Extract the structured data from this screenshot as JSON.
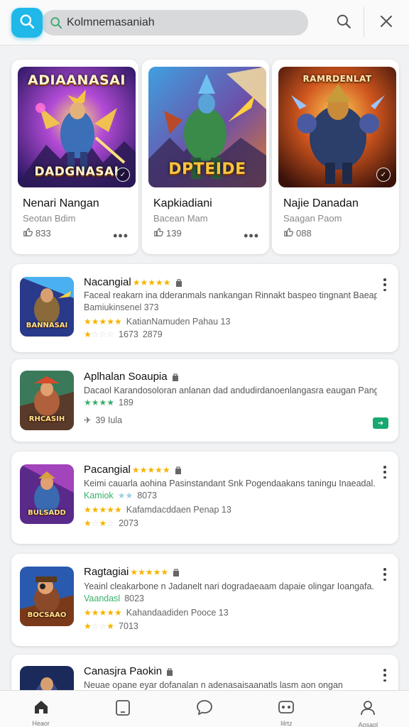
{
  "search": {
    "placeholder": "Kolmnemasaniah"
  },
  "icons": {
    "app": "search-icon",
    "search_field": "search-icon",
    "search_action": "search-icon",
    "close": "close-icon"
  },
  "colors": {
    "accent": "#1fb8e8",
    "star": "#f5b400",
    "install": "#18a870"
  },
  "featured": [
    {
      "art_title": "ADIAANASAI",
      "art_subtitle": "DADGNASAI",
      "title": "Nenari Nangan",
      "subtitle": "Seotan Bdim",
      "stat": "833"
    },
    {
      "art_title": "",
      "art_subtitle": "DPTEIDE",
      "title": "Kapkiadiani",
      "subtitle": "Bacean Mam",
      "stat": "139"
    },
    {
      "art_title": "RAMRDENLAT",
      "art_subtitle": "",
      "title": "Najie Danadan",
      "subtitle": "Saagan Paom",
      "stat": "088"
    }
  ],
  "list": [
    {
      "thumb_label": "BANNASAI",
      "title": "Nacangial",
      "desc": "Faceal reakarn ina dderanmals nankangan Rinnakt baspeo tingnant Baeaptl.",
      "line2": "Bamiukinsenel 373",
      "line3_extra": "KatianNamuden Pahau 13",
      "line3_rating": "2879",
      "line4": "1673"
    },
    {
      "thumb_label": "RHCASIH",
      "title": "Aplhalan Soaupia",
      "desc": "Dacaol Karandosoloran anlanan dad andudirdanoenlangasra eaugan Pangako.",
      "rating": "189",
      "sub": "39 Iula"
    },
    {
      "thumb_label": "BULSADD",
      "title": "Pacangial",
      "desc": "Keimi cauarla aohina Pasinstandant Snk Pogendaakans taningu Inaeadal.",
      "line2_name": "Kamiok",
      "line2": "8073",
      "line3_extra": "Kafamdacddaen Penap 13",
      "line4": "2073"
    },
    {
      "thumb_label": "BOCSAAO",
      "title": "Ragtagiai",
      "desc": "Yeainl cleakarbone n Jadanelt nari dogradaeaam dapaie olingar Ioangafa.",
      "line2_name": "Vaandasl",
      "line2": "8023",
      "line3_extra": "Kahandaadiden Pooce 13",
      "line4": "7013"
    },
    {
      "thumb_label": "",
      "title": "Canasjra Paokin",
      "desc": "Neuae opane eyar dofanalan n adenasaisaanatls lasm aon ongan"
    }
  ],
  "nav": [
    {
      "label": "Heaor",
      "icon": "home-icon"
    },
    {
      "label": "",
      "icon": "tablet-icon"
    },
    {
      "label": "",
      "icon": "chat-icon"
    },
    {
      "label": "Iilrtz",
      "icon": "gamepad-icon"
    },
    {
      "label": "Aosaol",
      "icon": "profile-icon"
    }
  ]
}
